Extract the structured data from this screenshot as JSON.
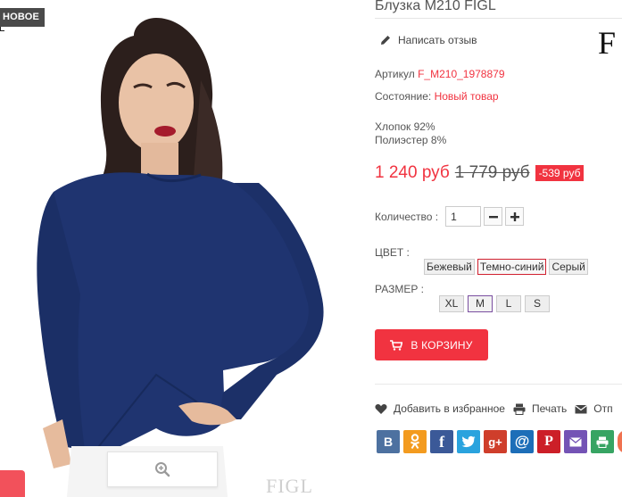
{
  "badge": {
    "new": "НОВОЕ"
  },
  "image": {
    "watermark": "FIGL"
  },
  "product": {
    "title": "Блузка M210 FIGL",
    "brand_logo": "F",
    "review_label": "Написать отзыв",
    "article_label": "Артикул",
    "article_value": "F_M210_1978879",
    "condition_label": "Состояние:",
    "condition_value": "Новый товар",
    "composition": [
      "Хлопок 92%",
      "Полиэстер 8%"
    ],
    "price_current": "1 240 руб",
    "price_old": "1 779 руб",
    "discount": "-539 руб"
  },
  "quantity": {
    "label": "Количество :",
    "value": "1",
    "minus_icon": "minus-icon",
    "plus_icon": "plus-icon"
  },
  "color": {
    "label": "ЦВЕТ :",
    "options": [
      "Бежевый",
      "Темно-синий",
      "Серый"
    ],
    "selected": "Темно-синий"
  },
  "size": {
    "label": "РАЗМЕР :",
    "options": [
      "XL",
      "M",
      "L",
      "S"
    ],
    "selected": "M"
  },
  "cart": {
    "label": "В КОРЗИНУ"
  },
  "actions": {
    "favorite": "Добавить в избранное",
    "print": "Печать",
    "send": "Отп"
  },
  "share": {
    "vk": "В",
    "ok": "ok-icon",
    "facebook": "f",
    "twitter": "twitter-icon",
    "gplus": "g+",
    "mailru": "@",
    "pinterest": "P",
    "email": "mail-icon",
    "print": "print-icon"
  },
  "colors": {
    "accent": "#f13340",
    "vk": "#4d71a0",
    "ok": "#f39b1f",
    "facebook": "#3b5998",
    "twitter": "#2aa3de",
    "gplus": "#cf3e2b",
    "mailru": "#1d6eb8",
    "pinterest": "#cc1f28",
    "email": "#7453b5",
    "print": "#37a463"
  }
}
